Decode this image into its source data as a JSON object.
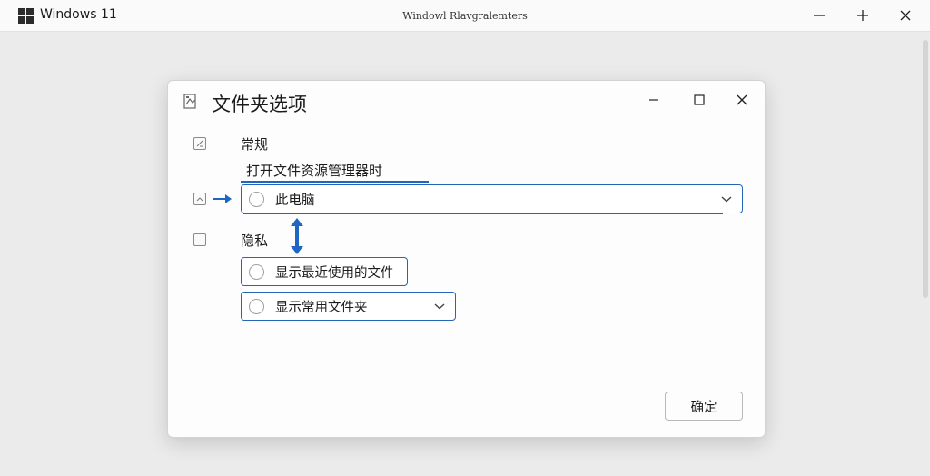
{
  "window": {
    "app_title": "Windows 11",
    "center_title": "Windowl Rlavgralemters"
  },
  "dialog": {
    "title": "文件夹选项",
    "general_label": "常规",
    "open_explorer_label": "打开文件资源管理器时",
    "open_explorer_value": "此电脑",
    "privacy_label": "隐私",
    "show_recent_files": "显示最近使用的文件",
    "show_frequent_folders": "显示常用文件夹",
    "ok_label": "确定"
  },
  "colors": {
    "accent": "#2465b5",
    "arrow": "#1e66c2"
  },
  "icons": [
    "windows-logo-icon",
    "minimize-icon",
    "maximize-icon",
    "close-icon",
    "folder-options-icon",
    "chevron-down-icon",
    "arrow-right-icon",
    "double-arrow-icon"
  ]
}
